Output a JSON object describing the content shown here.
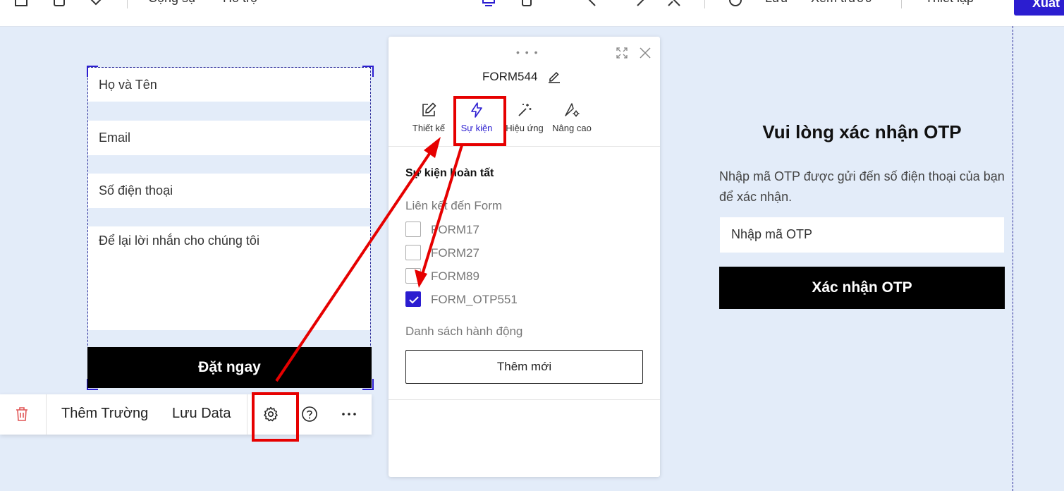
{
  "topbar": {
    "menu_colleague": "Cộng sự",
    "menu_support": "Hỗ trợ",
    "save_label": "Lưu",
    "preview_label": "Xem trước",
    "settings_label": "Thiết lập",
    "export_label": "Xuất"
  },
  "lead_form": {
    "fields": [
      {
        "placeholder": "Họ và Tên"
      },
      {
        "placeholder": "Email"
      },
      {
        "placeholder": "Số điện thoại"
      },
      {
        "placeholder": "Để lại lời nhắn cho chúng tôi"
      }
    ],
    "submit_label": "Đặt ngay"
  },
  "toolbar": {
    "add_field_label": "Thêm Trường",
    "save_data_label": "Lưu Data",
    "icons": [
      "trash-icon",
      "gear-icon",
      "help-icon",
      "more-icon"
    ]
  },
  "panel": {
    "title": "FORM544",
    "tabs": [
      {
        "label": "Thiết kế",
        "icon": "pencil-square-icon",
        "active": false
      },
      {
        "label": "Sự kiện",
        "icon": "lightning-icon",
        "active": true
      },
      {
        "label": "Hiệu ứng",
        "icon": "magic-wand-icon",
        "active": false
      },
      {
        "label": "Nâng cao",
        "icon": "pen-gear-icon",
        "active": false
      }
    ],
    "section_title": "Sự kiện hoàn tất",
    "link_label": "Liên kết đến Form",
    "forms": [
      {
        "name": "FORM17",
        "checked": false
      },
      {
        "name": "FORM27",
        "checked": false
      },
      {
        "name": "FORM89",
        "checked": false
      },
      {
        "name": "FORM_OTP551",
        "checked": true
      }
    ],
    "actions_label": "Danh sách hành động",
    "add_button_label": "Thêm mới"
  },
  "otp_form": {
    "title": "Vui lòng xác nhận OTP",
    "description": "Nhập mã OTP được gửi đến số điện thoại của bạn để xác nhận.",
    "input_placeholder": "Nhập mã OTP",
    "submit_label": "Xác nhận OTP"
  },
  "colors": {
    "accent": "#2b1dd0",
    "annotation": "#e60000",
    "canvas_bg": "#e3ecf9"
  }
}
